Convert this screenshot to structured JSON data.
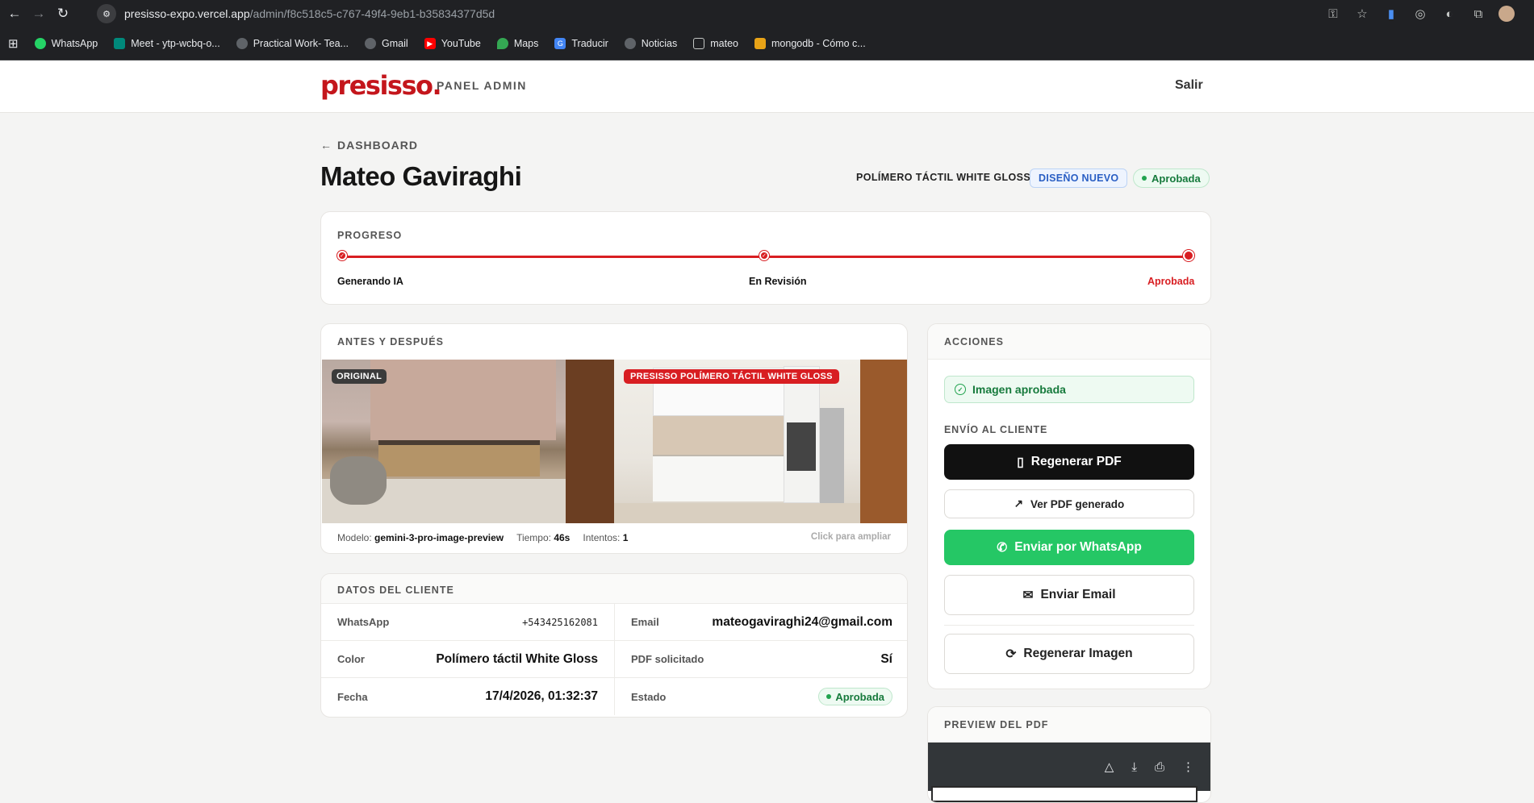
{
  "browser": {
    "url_host": "presisso-expo.vercel.app",
    "url_path": "/admin/f8c518c5-c767-49f4-9eb1-b35834377d5d",
    "bookmarks": [
      {
        "label": "WhatsApp",
        "icon": "whatsapp-icon",
        "color": "#25d366"
      },
      {
        "label": "Meet - ytp-wcbq-o...",
        "icon": "meet-icon",
        "color": "#00897b"
      },
      {
        "label": "Practical Work- Tea...",
        "icon": "globe-icon",
        "color": "#5f6368"
      },
      {
        "label": "Gmail",
        "icon": "globe-icon",
        "color": "#5f6368"
      },
      {
        "label": "YouTube",
        "icon": "youtube-icon",
        "color": "#ff0000"
      },
      {
        "label": "Maps",
        "icon": "maps-icon",
        "color": "#34a853"
      },
      {
        "label": "Traducir",
        "icon": "translate-icon",
        "color": "#4285f4"
      },
      {
        "label": "Noticias",
        "icon": "globe-icon",
        "color": "#5f6368"
      },
      {
        "label": "mateo",
        "icon": "folder-icon",
        "color": "#5f6368"
      },
      {
        "label": "mongodb - Cómo c...",
        "icon": "mongodb-icon",
        "color": "#e8a317"
      }
    ]
  },
  "header": {
    "logo": "presisso.",
    "panel_label": "PANEL ADMIN",
    "logout": "Salir"
  },
  "page": {
    "back_label": "DASHBOARD",
    "client_name": "Mateo Gaviraghi",
    "product": "POLÍMERO TÁCTIL WHITE GLOSS",
    "badge_new": "DISEÑO NUEVO",
    "status_badge": "Aprobada"
  },
  "progress": {
    "title": "PROGRESO",
    "steps": [
      "Generando IA",
      "En Revisión",
      "Aprobada"
    ],
    "current_step": 3
  },
  "before_after": {
    "title": "ANTES Y DESPUÉS",
    "original_tag": "ORIGINAL",
    "new_tag": "PRESISSO POLÍMERO TÁCTIL WHITE GLOSS",
    "model_label": "Modelo:",
    "model_value": "gemini-3-pro-image-preview",
    "time_label": "Tiempo:",
    "time_value": "46s",
    "attempts_label": "Intentos:",
    "attempts_value": "1",
    "hint": "Click para ampliar"
  },
  "client_data": {
    "title": "DATOS DEL CLIENTE",
    "rows": [
      [
        {
          "label": "WhatsApp",
          "value": "+543425162081"
        },
        {
          "label": "Email",
          "value": "mateogaviraghi24@gmail.com"
        }
      ],
      [
        {
          "label": "Color",
          "value": "Polímero táctil White Gloss"
        },
        {
          "label": "PDF solicitado",
          "value": "Sí"
        }
      ],
      [
        {
          "label": "Fecha",
          "value": "17/4/2026, 01:32:37"
        },
        {
          "label": "Estado",
          "value": "Aprobada"
        }
      ]
    ]
  },
  "actions": {
    "title": "ACCIONES",
    "approved_notice": "Imagen aprobada",
    "send_section": "ENVÍO AL CLIENTE",
    "regen_pdf": "Regenerar PDF",
    "view_pdf": "Ver PDF generado",
    "send_whatsapp": "Enviar por WhatsApp",
    "send_email": "Enviar Email",
    "regen_image": "Regenerar Imagen"
  },
  "preview": {
    "title": "PREVIEW DEL PDF"
  },
  "colors": {
    "brand_red": "#d81e22",
    "whatsapp_green": "#25c765",
    "success_green": "#167a3c"
  }
}
